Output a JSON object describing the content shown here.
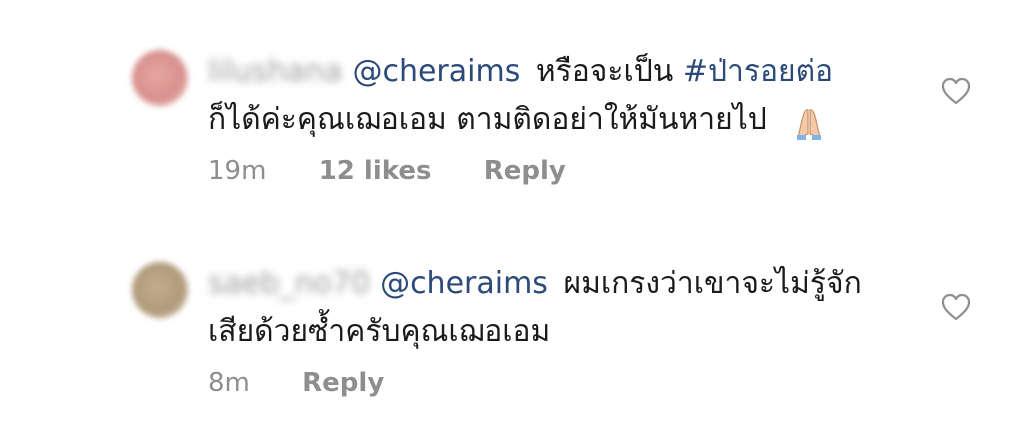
{
  "comments": [
    {
      "username": "lilushana",
      "mention": "@cheraims",
      "text_a": "หรือจะเป็น",
      "hashtag": "#ป่ารอยต่อ",
      "text_b": "ก็ได้ค่ะคุณเฌอเอม ตามติดอย่าให้มันหายไป",
      "emoji": "folded-hands-emoji",
      "time": "19m",
      "likes": "12 likes",
      "reply": "Reply"
    },
    {
      "username": "saeb_no70",
      "mention": "@cheraims",
      "text_a": "ผมเกรงว่าเขาจะไม่รู้จักเสียด้วยซ้ำครับคุณเฌอเอม",
      "time": "8m",
      "reply": "Reply"
    }
  ],
  "colors": {
    "mention": "#2b4a7a",
    "meta": "#8e8e8e",
    "heart_stroke": "#8e8e8e"
  },
  "icons": {
    "like": "heart-outline-icon",
    "emoji": "folded-hands-emoji"
  }
}
